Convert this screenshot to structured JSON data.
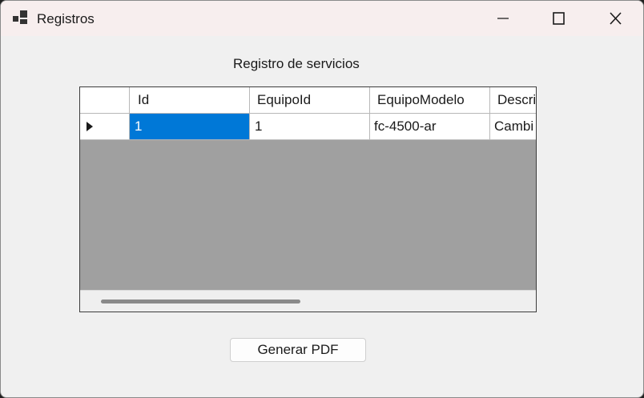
{
  "window": {
    "title": "Registros",
    "icon": "app-window-icon",
    "controls": {
      "minimize_icon": "minimize-icon",
      "maximize_icon": "maximize-icon",
      "close_icon": "close-icon"
    }
  },
  "main": {
    "heading": "Registro de servicios",
    "grid": {
      "columns": [
        "Id",
        "EquipoId",
        "EquipoModelo",
        "Descri"
      ],
      "rows": [
        {
          "cells": [
            "1",
            "1",
            "fc-4500-ar",
            "Cambi"
          ],
          "current": true,
          "selected_column": "Id"
        }
      ]
    },
    "generate_button": "Generar PDF"
  },
  "colors": {
    "selection": "#0078d7",
    "grid_background": "#a0a0a0",
    "window_background": "#f0f0f0",
    "titlebar": "#f7eeee"
  }
}
